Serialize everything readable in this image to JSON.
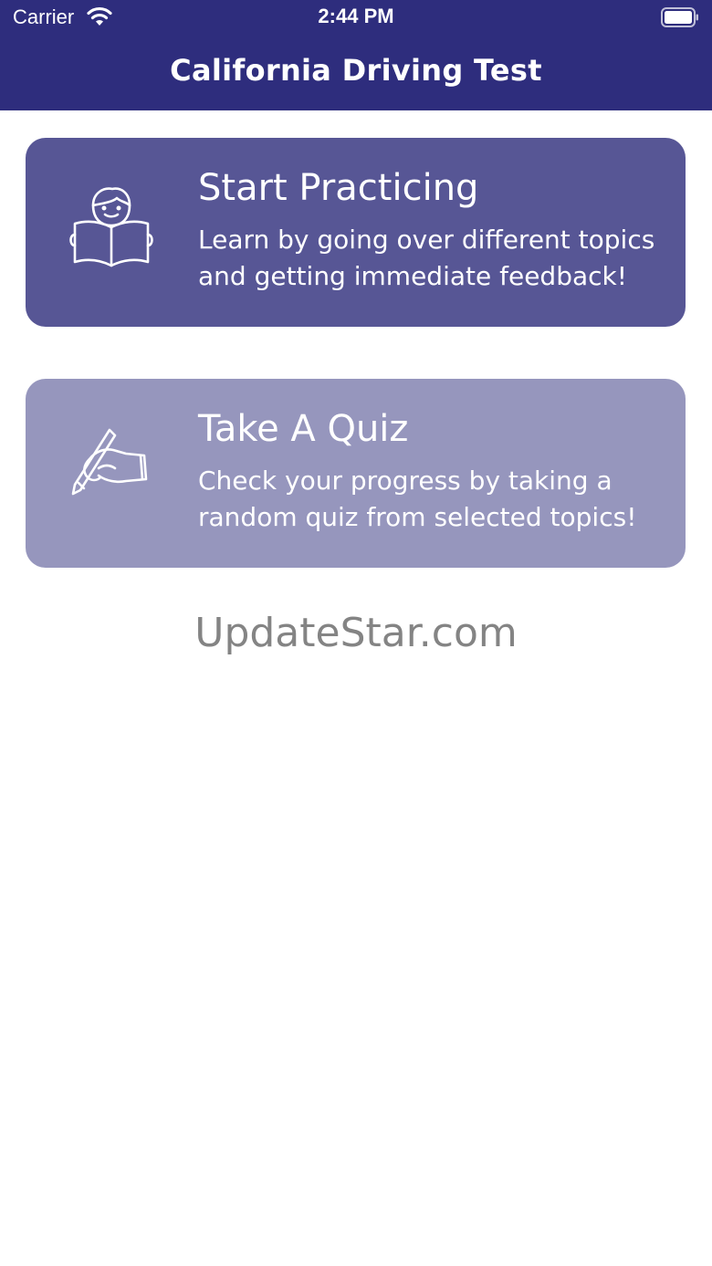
{
  "status_bar": {
    "carrier": "Carrier",
    "time": "2:44 PM",
    "wifi_icon": "wifi-icon",
    "battery_icon": "battery-icon"
  },
  "header": {
    "title": "California Driving Test",
    "background_color": "#2e2d7d"
  },
  "cards": [
    {
      "title": "Start Practicing",
      "description": "Learn by going over different topics and getting immediate feedback!",
      "icon": "reading-person-icon",
      "color": "#575695"
    },
    {
      "title": "Take A Quiz",
      "description": "Check your progress by taking a random quiz from selected topics!",
      "icon": "writing-hand-icon",
      "color": "#9696bd"
    }
  ],
  "watermark": "UpdateStar.com"
}
